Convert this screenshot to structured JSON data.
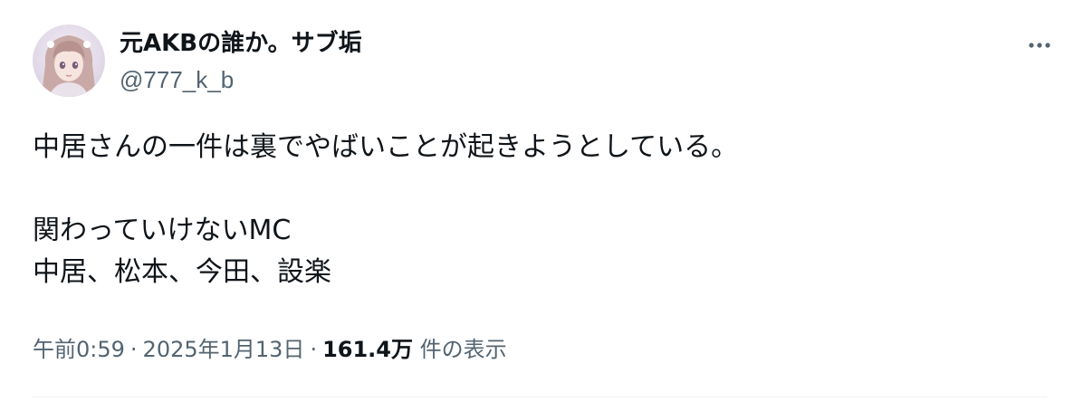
{
  "tweet": {
    "author": {
      "display_name": "元AKBの誰か。サブ垢",
      "handle": "@777_k_b"
    },
    "body_lines": [
      "中居さんの一件は裏でやばいことが起きようとしている。",
      "",
      "関わっていけないMC",
      "中居、松本、今田、設楽"
    ],
    "meta": {
      "time": "午前0:59",
      "separator": "·",
      "date": "2025年1月13日",
      "views_count": "161.4万",
      "views_label": "件の表示"
    },
    "more_icon": "more-horizontal-icon"
  },
  "colors": {
    "text_primary": "#0f1419",
    "text_secondary": "#536471",
    "divider": "#eff3f4"
  }
}
